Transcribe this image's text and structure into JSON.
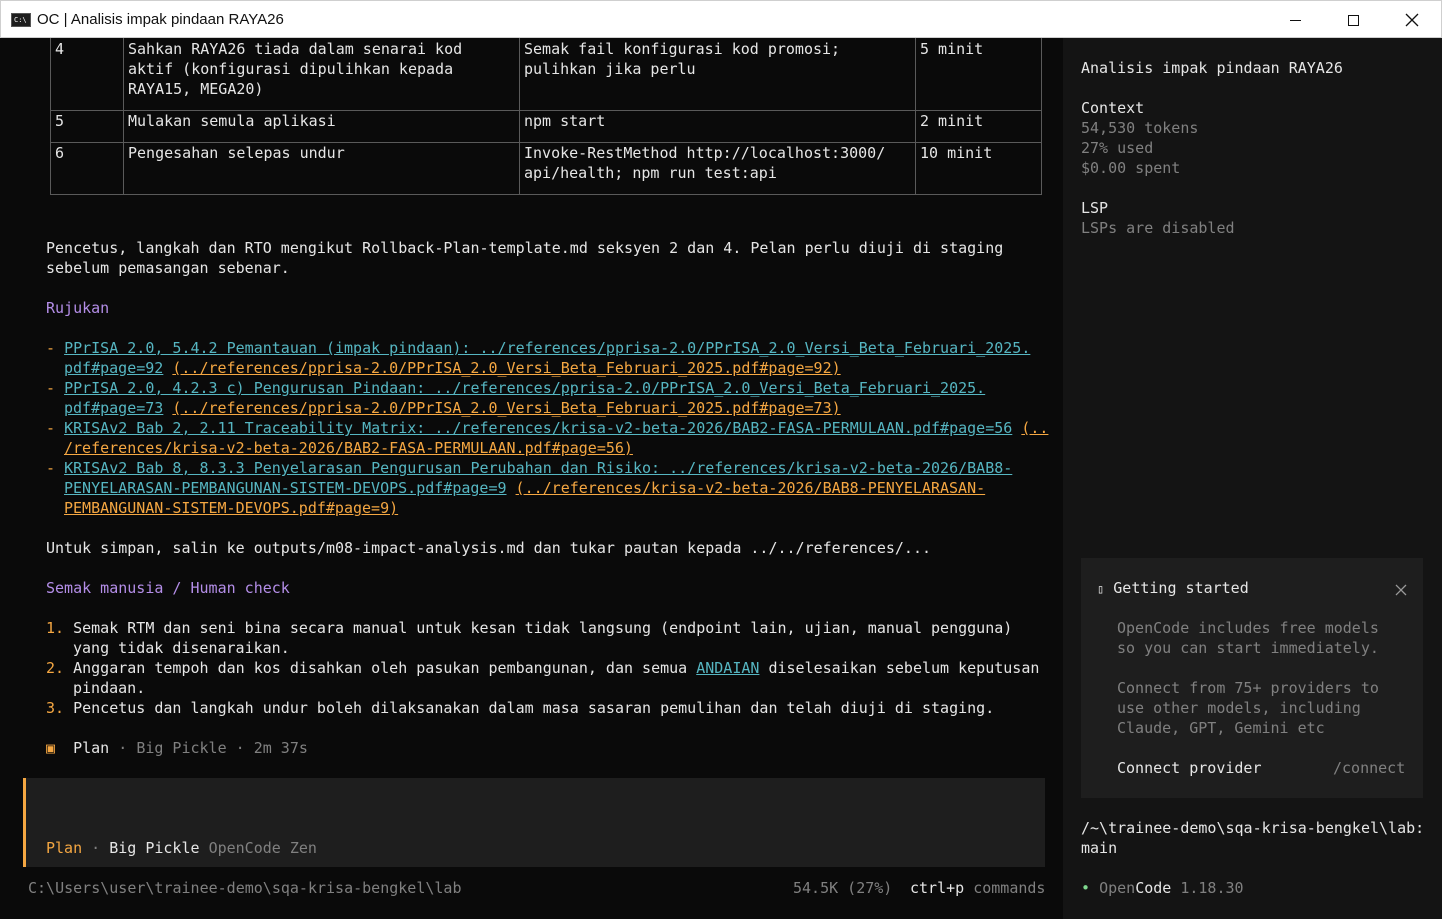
{
  "window": {
    "title": "OC | Analisis impak pindaan RAYA26",
    "icon": "terminal-icon"
  },
  "table": {
    "rows": [
      {
        "no": "4",
        "step": "Sahkan RAYA26 tiada dalam senarai kod\naktif (konfigurasi dipulihkan kepada\nRAYA15, MEGA20)",
        "action": "Semak fail konfigurasi kod promosi;\npulihkan jika perlu",
        "time": "5 minit",
        "code": false
      },
      {
        "no": "5",
        "step": "Mulakan semula aplikasi",
        "action": "npm start",
        "time": "2 minit",
        "code": true
      },
      {
        "no": "6",
        "step": "Pengesahan selepas undur",
        "action": "Invoke-RestMethod http://localhost:3000/\napi/health; npm run test:api",
        "time": "10 minit",
        "code": true
      }
    ]
  },
  "para1": "Pencetus, langkah dan RTO mengikut Rollback-Plan-template.md seksyen 2 dan 4. Pelan perlu diuji di staging\nsebelum pemasangan sebenar.",
  "refs": {
    "heading": "Rujukan",
    "items": [
      {
        "l1a": "PPrISA 2.0, 5.4.2 Pemantauan (impak pindaan): ../references/pprisa-2.0/PPrISA_2.0_Versi_Beta_Februari_2025.",
        "l2a": "pdf#page=92",
        "l2b": "(../references/pprisa-2.0/PPrISA_2.0_Versi_Beta_Februari_2025.pdf#page=92)"
      },
      {
        "l1a": "PPrISA 2.0, 4.2.3 c) Pengurusan Pindaan: ../references/pprisa-2.0/PPrISA_2.0_Versi_Beta_Februari_2025.",
        "l2a": "pdf#page=73",
        "l2b": "(../references/pprisa-2.0/PPrISA_2.0_Versi_Beta_Februari_2025.pdf#page=73)"
      },
      {
        "l1a": "KRISAv2 Bab 2, 2.11 Traceability Matrix: ../references/krisa-v2-beta-2026/BAB2-FASA-PERMULAAN.pdf#page=56",
        "l1b": "(..",
        "l2b": "/references/krisa-v2-beta-2026/BAB2-FASA-PERMULAAN.pdf#page=56)"
      },
      {
        "l1a": "KRISAv2 Bab 8, 8.3.3 Penyelarasan Pengurusan Perubahan dan Risiko: ../references/krisa-v2-beta-2026/BAB8-",
        "l2a": "PENYELARASAN-PEMBANGUNAN-SISTEM-DEVOPS.pdf#page=9",
        "l2b": "(../references/krisa-v2-beta-2026/BAB8-PENYELARASAN-",
        "l3b": "PEMBANGUNAN-SISTEM-DEVOPS.pdf#page=9)"
      }
    ]
  },
  "save_note": "Untuk simpan, salin ke outputs/m08-impact-analysis.md dan tukar pautan kepada ../../references/...",
  "human": {
    "heading": "Semak manusia / Human check",
    "i1a": "Semak RTM dan seni bina secara manual untuk kesan tidak langsung (endpoint lain, ujian, manual pengguna)",
    "i1b": "yang tidak disenaraikan.",
    "i2a": "Anggaran tempoh dan kos disahkan oleh pasukan pembangunan, dan semua ",
    "i2u": "ANDAIAN",
    "i2c": " diselesaikan sebelum keputusan",
    "i2d": "pindaan.",
    "i3a": "Pencetus dan langkah undur boleh dilaksanakan dalam masa sasaran pemulihan dan telah diuji di staging."
  },
  "meta": {
    "mode": "Plan",
    "model": "Big Pickle",
    "duration": "2m 37s",
    "sep": "·"
  },
  "input": {
    "mode": "Plan",
    "model": "Big Pickle",
    "provider": "OpenCode Zen",
    "sep": "·"
  },
  "status": {
    "path": "C:\\Users\\user\\trainee-demo\\sqa-krisa-bengkel\\lab",
    "usage": "54.5K (27%)",
    "shortcut": "ctrl+p",
    "shortcut_label": "commands"
  },
  "sidebar": {
    "title": "Analisis impak pindaan RAYA26",
    "context_label": "Context",
    "tokens": "54,530 tokens",
    "used": "27% used",
    "spent": "$0.00 spent",
    "lsp_label": "LSP",
    "lsp_status": "LSPs are disabled",
    "getting_started": {
      "title": "Getting started",
      "p1": "OpenCode includes free models\nso you can start immediately.",
      "p2": "Connect from 75+ providers to\nuse other models, including\nClaude, GPT, Gemini etc",
      "connect_label": "Connect provider",
      "connect_cmd": "/connect"
    },
    "path": "/~\\trainee-demo\\sqa-krisa-bengkel\\lab:\nmain",
    "app_name_a": "Open",
    "app_name_b": "Code",
    "version": "1.18.30"
  },
  "colors": {
    "accent": "#f5a742",
    "link": "#56b6c2",
    "heading": "#b48ee8",
    "code": "#7fd88f",
    "status_dot": "#7fd88f"
  }
}
